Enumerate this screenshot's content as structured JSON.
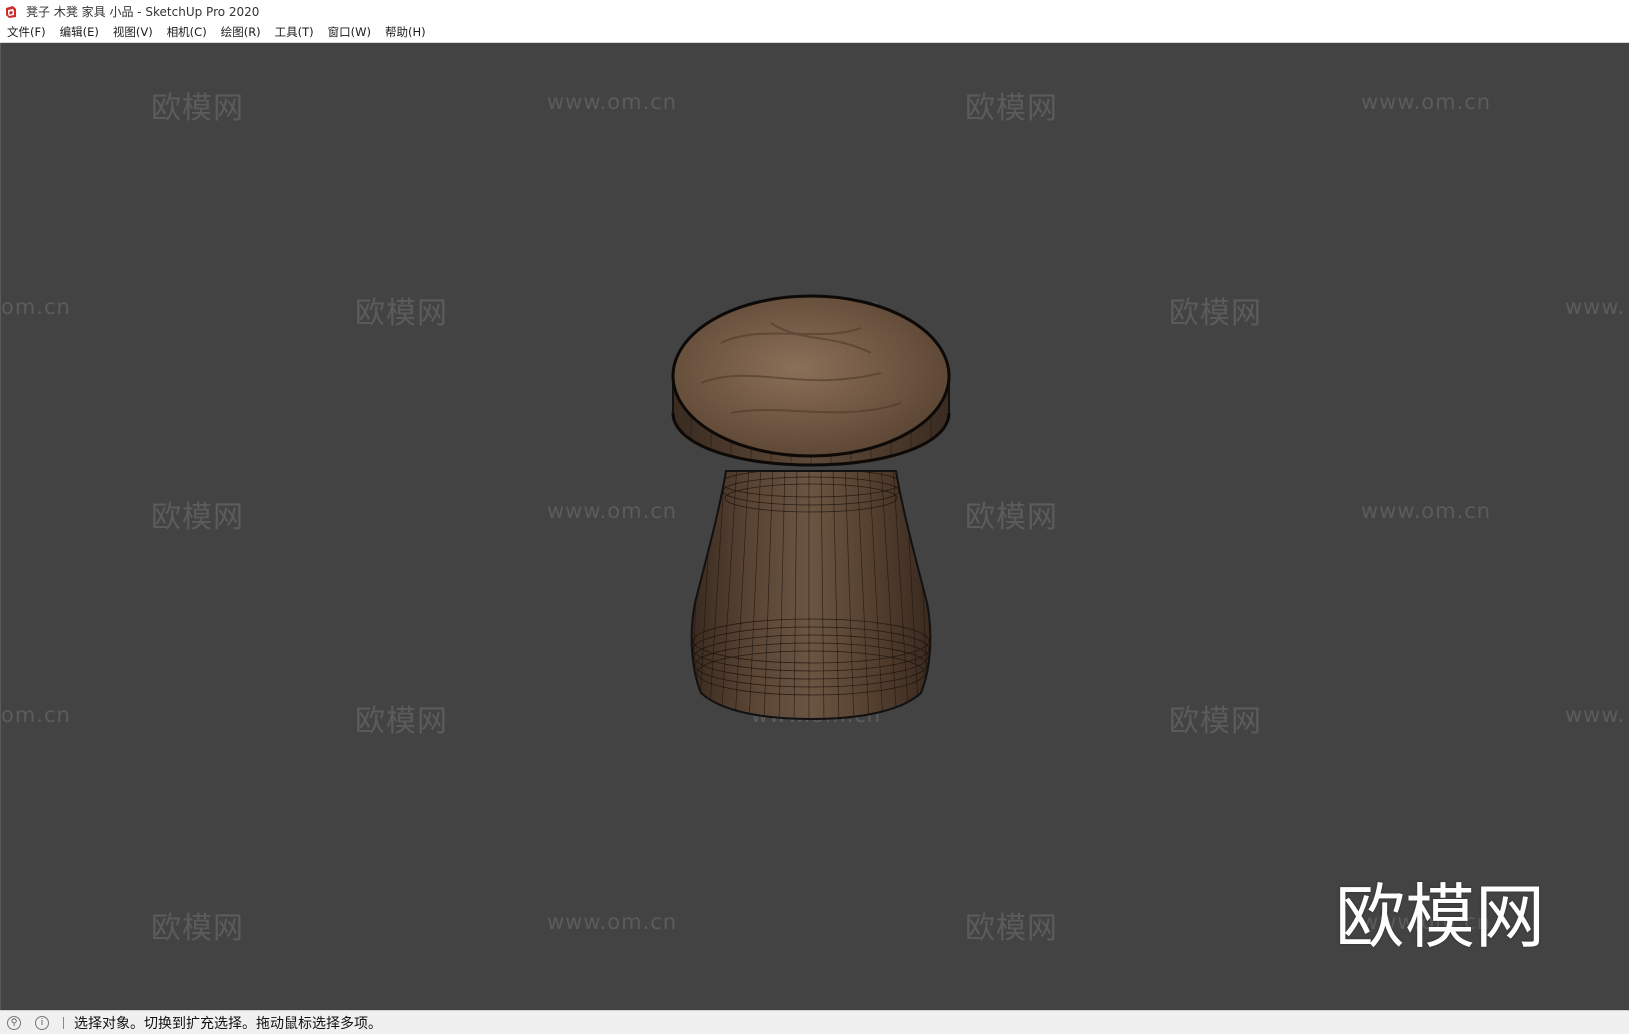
{
  "window": {
    "title": "凳子 木凳 家具 小品 - SketchUp Pro 2020",
    "app_icon": "sketchup-logo-icon"
  },
  "menu": {
    "items": [
      {
        "label": "文件(F)"
      },
      {
        "label": "编辑(E)"
      },
      {
        "label": "视图(V)"
      },
      {
        "label": "相机(C)"
      },
      {
        "label": "绘图(R)"
      },
      {
        "label": "工具(T)"
      },
      {
        "label": "窗口(W)"
      },
      {
        "label": "帮助(H)"
      }
    ]
  },
  "viewport": {
    "background_color": "#434343",
    "model": "wooden-stool",
    "watermark_text": "欧模网",
    "watermark_url": "www.om.cn",
    "watermark_url_partial_left": "om.cn",
    "watermark_url_partial_right": "www.",
    "brand_logo_text": "欧模网"
  },
  "status": {
    "icons": [
      "geo-location-icon",
      "info-icon"
    ],
    "message": "选择对象。切换到扩充选择。拖动鼠标选择多项。"
  }
}
